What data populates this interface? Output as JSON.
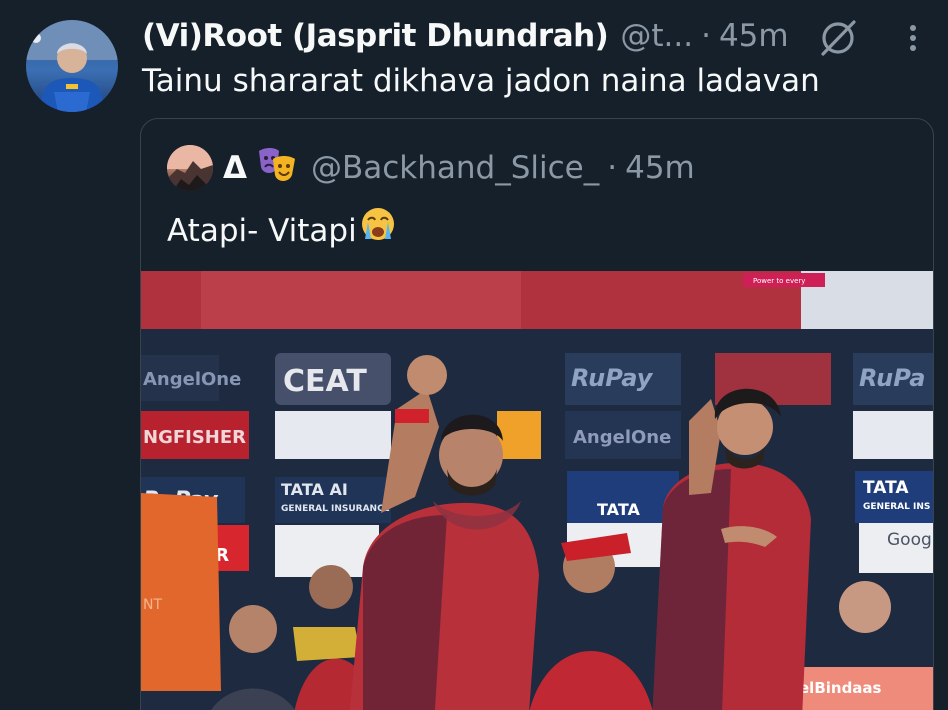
{
  "tweet": {
    "author_name": "(Vi)Root (Jasprit Dhundrah)",
    "author_handle": "@t...",
    "separator": "·",
    "time": "45m",
    "text": "Tainu shararat dikhava jadon naina ladavan",
    "icons": {
      "avatar": "avatar-photo",
      "grok": "grok-icon",
      "more": "more-vertical-icon"
    }
  },
  "quoted": {
    "author_name": "Δ",
    "author_emoji_icon": "performing-arts-mask-icon",
    "author_handle": "@Backhand_Slice_",
    "separator": "·",
    "time": "45m",
    "text": "Atapi- Vitapi",
    "text_emoji_icon": "loudly-crying-face-icon",
    "media": {
      "kind": "photo",
      "sponsor_boards": [
        "AngelOne",
        "CEAT",
        "RuPay",
        "RuPa",
        "NGFISHER",
        "AngelOne",
        "RuPay",
        "TATA AI",
        "GENERAL INSURANCE",
        "TATA",
        "TATA",
        "GENERAL INS",
        "ER",
        "NT",
        "Goog",
        "elBindaas",
        "Power to every"
      ]
    }
  },
  "colors": {
    "background": "#15202b",
    "text": "#f7f9f9",
    "secondary": "#8b98a5",
    "border": "#38444d"
  }
}
